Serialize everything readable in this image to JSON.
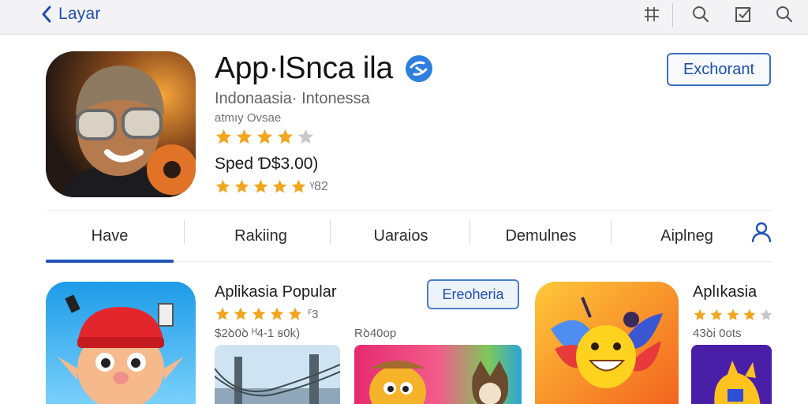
{
  "nav": {
    "back_label": "Layar"
  },
  "toolbar": {
    "icons": [
      "grid-icon",
      "search-icon",
      "checkbox-icon",
      "search-icon"
    ]
  },
  "app": {
    "title": "App·lSnca ila",
    "developer": "Indonaasia· Intonessa",
    "subtext": "atmıy Ovsae",
    "rating_stars": 4,
    "price": "Sped Ɗ$3.00)",
    "rating2_stars": 5,
    "rating2_count": "ᵞ82",
    "get_button": "Exchorant",
    "accent_color": "#2154b8",
    "star_color": "#f2a51e"
  },
  "tabs": {
    "items": [
      "Have",
      "Rakiing",
      "Uaraios",
      "Demulnes",
      "Aiplneg"
    ],
    "active_index": 0
  },
  "popular": {
    "title": "Aplikasia Popular",
    "stars": 5,
    "count": "ꟳ3",
    "meta": "$2ꝺ0ꝺ ᴴ4-1 ꞩ0k)",
    "meta2": "Rꝺ40op",
    "open_button": "Ereoheria"
  },
  "right_card": {
    "title": "Aplıkasia",
    "stars": 4,
    "meta": "43ꝺi 0ots"
  }
}
